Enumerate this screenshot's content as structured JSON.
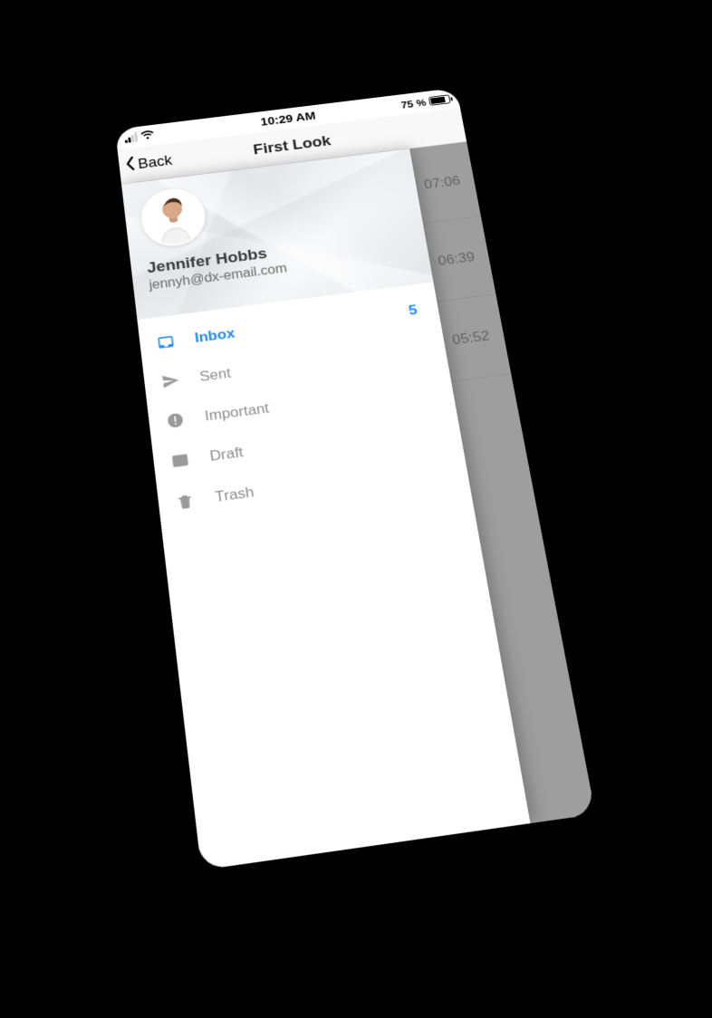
{
  "status": {
    "time": "10:29 AM",
    "battery_text": "75 %"
  },
  "nav": {
    "back_label": "Back",
    "title": "First Look"
  },
  "profile": {
    "name": "Jennifer Hobbs",
    "email": "jennyh@dx-email.com"
  },
  "menu": {
    "items": [
      {
        "label": "Inbox",
        "icon": "inbox-icon",
        "active": true,
        "badge": "5"
      },
      {
        "label": "Sent",
        "icon": "send-icon",
        "active": false,
        "badge": ""
      },
      {
        "label": "Important",
        "icon": "important-icon",
        "active": false,
        "badge": ""
      },
      {
        "label": "Draft",
        "icon": "draft-icon",
        "active": false,
        "badge": ""
      },
      {
        "label": "Trash",
        "icon": "trash-icon",
        "active": false,
        "badge": ""
      }
    ]
  },
  "background_rows": {
    "times": [
      "07:06",
      "06:39",
      "05:52"
    ]
  },
  "colors": {
    "accent": "#1e88ff"
  }
}
